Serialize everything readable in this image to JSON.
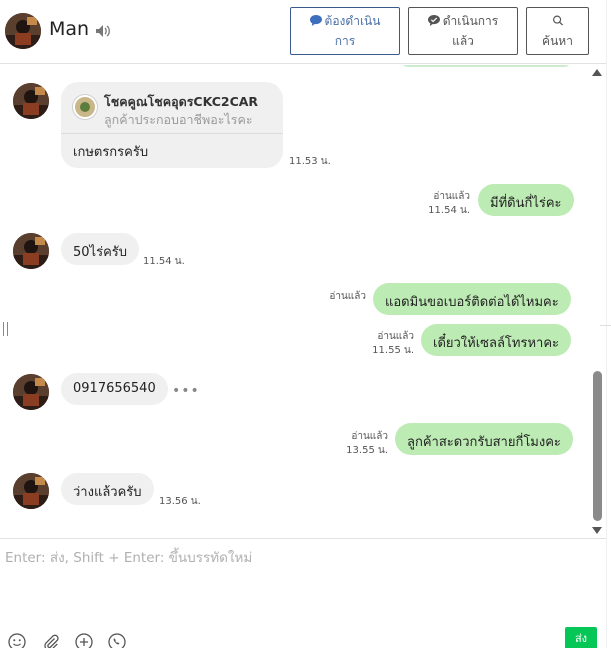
{
  "header": {
    "contact_name": "Man",
    "buttons": {
      "todo_line1": "ต้องดำเนิน",
      "todo_line2": "การ",
      "done_line1": "ดำเนินการ",
      "done_line2": "แล้ว",
      "search": "ค้นหา"
    }
  },
  "messages": {
    "card": {
      "title": "โชคคูณโชคอุดรCKC2CAR",
      "subtitle": "ลูกค้าประกอบอาชีพอะไรคะ",
      "reply": "เกษตรกรครับ",
      "time": "11.53 น."
    },
    "m1": {
      "text": "มีที่ดินกี่ไร่คะ",
      "read": "อ่านแล้ว",
      "time": "11.54 น."
    },
    "m2": {
      "text": "50ไร่ครับ",
      "time": "11.54 น."
    },
    "m3": {
      "text": "แอดมินขอเบอร์ติดต่อได้ไหมคะ",
      "read": "อ่านแล้ว"
    },
    "m4": {
      "text": "เดี๋ยวให้เซลล์โทรหาคะ",
      "read": "อ่านแล้ว",
      "time": "11.55 น."
    },
    "m5": {
      "text": "0917656540",
      "more": "•••"
    },
    "m6": {
      "text": "ลูกค้าสะดวกรับสายกี่โมงคะ",
      "read": "อ่านแล้ว",
      "time": "13.55 น."
    },
    "m7": {
      "text": "ว่างแล้วครับ",
      "time": "13.56 น."
    }
  },
  "composer": {
    "placeholder": "Enter: ส่ง, Shift + Enter: ขึ้นบรรทัดใหม่",
    "send_label": "ส่ง"
  },
  "colors": {
    "outgoing_bubble": "#bdebb4",
    "incoming_bubble": "#f0f0f1",
    "send_button": "#06c755",
    "accent_blue": "#4a6fa8"
  },
  "icons": [
    "speaker-icon",
    "chat-bubble-icon",
    "check-chat-icon",
    "search-icon",
    "emoji-icon",
    "attachment-icon",
    "plus-circle-icon",
    "phone-icon"
  ]
}
